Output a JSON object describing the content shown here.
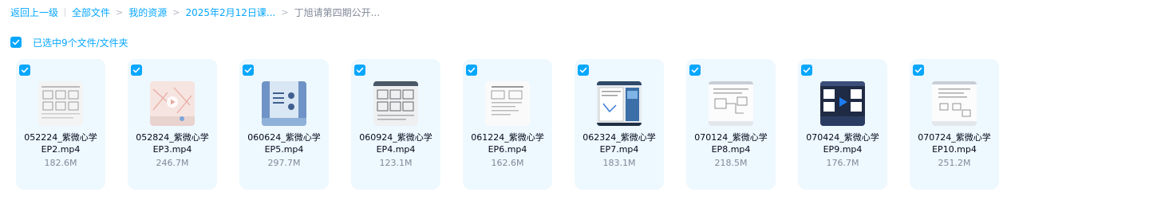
{
  "breadcrumb": {
    "back": "返回上一级",
    "all_files": "全部文件",
    "my_resources": "我的资源",
    "folder": "2025年2月12日课...",
    "current": "丁旭请第四期公开..."
  },
  "selection": {
    "label": "已选中9个文件/文件夹"
  },
  "accent_color": "#06a7ff",
  "files": [
    {
      "line1": "052224_紫微心学",
      "line2": "EP2.mp4",
      "size": "182.6M",
      "thumb": "doc-grid"
    },
    {
      "line1": "052824_紫微心学",
      "line2": "EP3.mp4",
      "size": "246.7M",
      "thumb": "pink-play"
    },
    {
      "line1": "060624_紫微心学",
      "line2": "EP5.mp4",
      "size": "297.7M",
      "thumb": "blue-slide"
    },
    {
      "line1": "060924_紫微心学",
      "line2": "EP4.mp4",
      "size": "123.1M",
      "thumb": "doc-grid-dark"
    },
    {
      "line1": "061224_紫微心学",
      "line2": "EP6.mp4",
      "size": "162.6M",
      "thumb": "doc-plain"
    },
    {
      "line1": "062324_紫微心学",
      "line2": "EP7.mp4",
      "size": "183.1M",
      "thumb": "screen-share"
    },
    {
      "line1": "070124_紫微心学",
      "line2": "EP8.mp4",
      "size": "218.5M",
      "thumb": "doc-diagram"
    },
    {
      "line1": "070424_紫微心学",
      "line2": "EP9.mp4",
      "size": "176.7M",
      "thumb": "dark-play"
    },
    {
      "line1": "070724_紫微心学",
      "line2": "EP10.mp4",
      "size": "251.2M",
      "thumb": "doc-diagram"
    }
  ]
}
